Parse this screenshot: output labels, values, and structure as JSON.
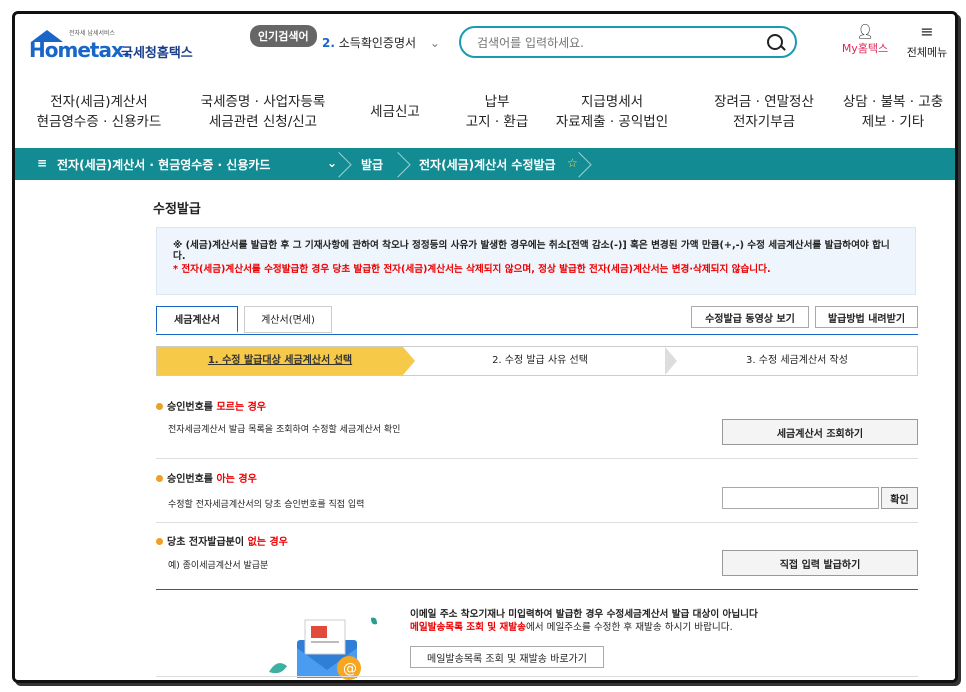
{
  "header": {
    "logo_tagline": "전자세 납세서비스",
    "logo_word": "Hometax.",
    "logo_kr": "국세청홈택스",
    "popular_label": "인기검색어",
    "popular_rank": "2.",
    "popular_item": "소득확인증명서",
    "search_placeholder": "검색어를 입력하세요.",
    "my_hometax": "My홈택스",
    "all_menu": "전체메뉴"
  },
  "nav": [
    {
      "line1": "전자(세금)계산서",
      "line2": "현금영수증 · 신용카드"
    },
    {
      "line1": "국세증명 · 사업자등록",
      "line2": "세금관련 신청/신고"
    },
    {
      "line1": "세금신고",
      "line2": ""
    },
    {
      "line1": "납부",
      "line2": "고지 · 환급"
    },
    {
      "line1": "지급명세서",
      "line2": "자료제출 · 공익법인"
    },
    {
      "line1": "장려금 · 연말정산",
      "line2": "전자기부금"
    },
    {
      "line1": "상담 · 불복 · 고충",
      "line2": "제보 · 기타"
    }
  ],
  "breadcrumb": {
    "menu_icon": "≡",
    "level1": "전자(세금)계산서 · 현금영수증 · 신용카드",
    "chevron": "⌄",
    "level2": "발급",
    "level3": "전자(세금)계산서 수정발급",
    "star": "☆"
  },
  "page": {
    "title": "수정발급",
    "notice_line1": "※ (세금)계산서를 발급한 후 그 기재사항에 관하여 착오나 정정등의 사유가 발생한 경우에는 취소[전액 감소(-)] 혹은 변경된 가액 만큼(+,-) 수정 세금계산서를 발급하여야 합니다.",
    "notice_line2": "* 전자(세금)계산서를 수정발급한 경우 당초 발급한 전자(세금)계산서는 삭제되지 않으며, 정상 발급한 전자(세금)계산서는 변경·삭제되지 않습니다.",
    "tabs": [
      "세금계산서",
      "계산서(면세)"
    ],
    "btn_video": "수정발급 동영상 보기",
    "btn_download": "발급방법 내려받기",
    "steps": [
      "1. 수정 발급대상 세금계산서 선택",
      "2. 수정 발급 사유 선택",
      "3. 수정 세금계산서 작성"
    ],
    "sections": [
      {
        "h_pre": "승인번호를 ",
        "h_red": "모르는 경우",
        "desc": "전자세금계산서 발급 목록을 조회하여 수정할 세금계산서 확인",
        "button": "세금계산서 조회하기"
      },
      {
        "h_pre": "승인번호를 ",
        "h_red": "아는 경우",
        "desc": "수정할 전자세금계산서의 당초 승인번호를 직접 입력",
        "button": "확인"
      },
      {
        "h_pre": "당초 전자발급분이 ",
        "h_red": "없는 경우",
        "desc": "예) 종이세금계산서 발급분",
        "button": "직접 입력 발급하기"
      }
    ],
    "mail_line1": "이메일 주소 착오기재나 미입력하여 발급한 경우 수정세금계산서 발급 대상이 아닙니다",
    "mail_red": "메일발송목록 조회 및 재발송",
    "mail_rest": "에서 메일주소를 수정한 후 재발송 하시기 바랍니다.",
    "mail_button": "메일발송목록 조회 및 재발송 바로가기"
  },
  "colors": {
    "brand": "#1a66c8",
    "breadcrumb": "#138b93",
    "step_active": "#f7c948",
    "alert": "#e00000"
  }
}
